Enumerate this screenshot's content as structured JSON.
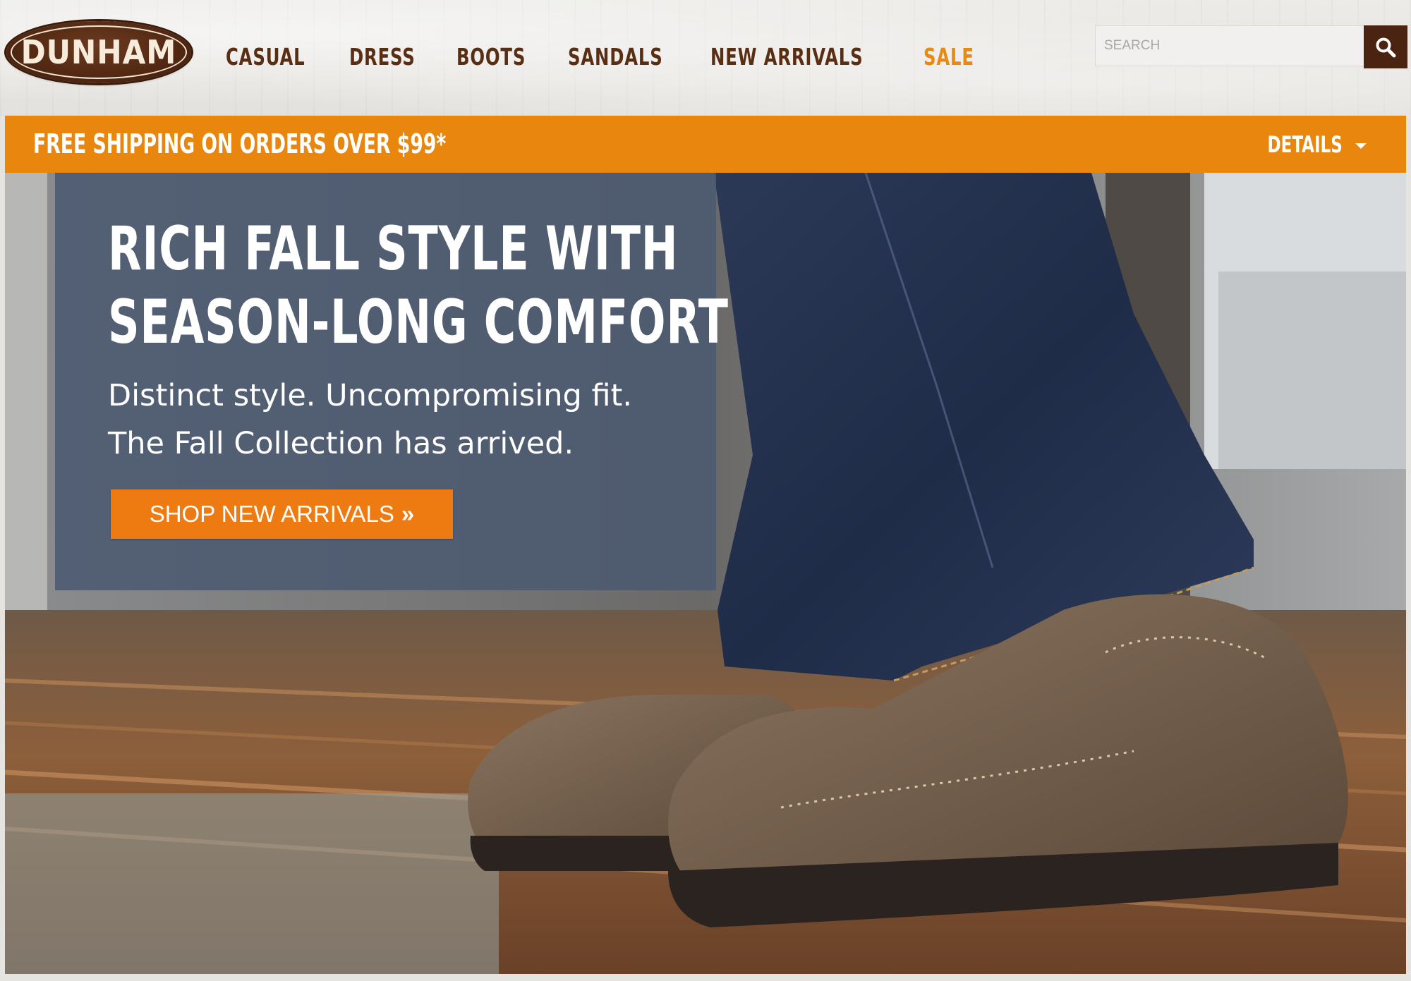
{
  "header": {
    "logo_text": "DUNHAM",
    "nav": [
      {
        "label": "CASUAL"
      },
      {
        "label": "DRESS"
      },
      {
        "label": "BOOTS"
      },
      {
        "label": "SANDALS"
      },
      {
        "label": "NEW ARRIVALS"
      },
      {
        "label": "SALE"
      }
    ],
    "search": {
      "placeholder": "SEARCH",
      "icon": "search-icon"
    }
  },
  "shipping_banner": {
    "text": "FREE SHIPPING ON ORDERS OVER $99*",
    "details_label": "DETAILS",
    "details_icon": "caret-down-icon"
  },
  "hero": {
    "headline_line1": "RICH FALL STYLE WITH",
    "headline_line2": "SEASON-LONG COMFORT",
    "sub_line1": "Distinct style. Uncompromising fit.",
    "sub_line2": "The Fall Collection has arrived.",
    "cta_label": "SHOP NEW ARRIVALS",
    "cta_icon": "double-chevron-right-icon"
  },
  "colors": {
    "brand_brown": "#5a2e12",
    "accent_orange": "#e8860d",
    "cta_orange": "#ee7a12",
    "panel_blue": "#4b5870"
  }
}
